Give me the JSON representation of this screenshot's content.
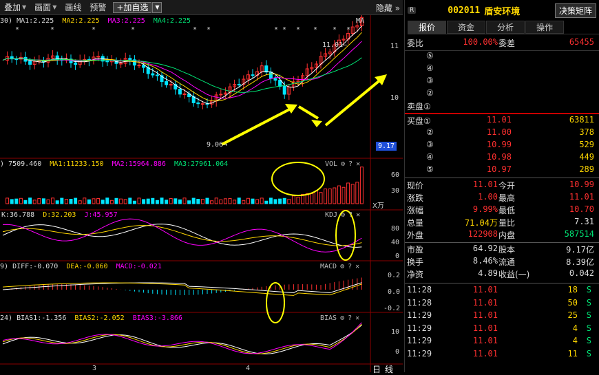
{
  "toolbar": {
    "overlay": "叠加",
    "canvas": "画面",
    "draw_line": "画线",
    "alert": "预警",
    "add_watch": "+加自选",
    "hide": "隐藏"
  },
  "main_chart": {
    "period_prefix": "30)",
    "ma1": "MA1:2.225",
    "ma2": "MA2:2.225",
    "ma3": "MA3:2.225",
    "ma4": "MA4:2.225",
    "ma_label": "MA",
    "high_label": "11.01",
    "low_label": "9.06",
    "axis": [
      "11",
      "10"
    ],
    "current_price": "9.17",
    "stars": [
      "*",
      "*",
      "*",
      "*",
      "*",
      "*",
      "* *",
      "*",
      "*",
      "*",
      "*"
    ]
  },
  "vol_pane": {
    "prefix": ")",
    "value": "7509.460",
    "ma1": "MA1:11233.150",
    "ma2": "MA2:15964.886",
    "ma3": "MA3:27961.064",
    "name": "VOL",
    "axis": [
      "60",
      "30"
    ],
    "unit": "X万"
  },
  "kdj_pane": {
    "k": "K:36.788",
    "d": "D:32.203",
    "j": "J:45.957",
    "name": "KDJ",
    "axis": [
      "80",
      "40",
      "0"
    ]
  },
  "macd_pane": {
    "prefix": "9)",
    "diff": "DIFF:-0.070",
    "dea": "DEA:-0.060",
    "macd": "MACD:-0.021",
    "name": "MACD",
    "axis": [
      "0.2",
      "0.0",
      "-0.2"
    ]
  },
  "bias_pane": {
    "prefix": "24)",
    "bias1": "BIAS1:-1.356",
    "bias2": "BIAS2:-2.052",
    "bias3": "BIAS3:-3.866",
    "name": "BIAS",
    "axis": [
      "10",
      "0"
    ]
  },
  "date_axis": [
    "3",
    "4"
  ],
  "period_buttons": [
    "日",
    "线"
  ],
  "right_panel": {
    "badge": "R",
    "code": "002011",
    "name": "盾安环境",
    "matrix_button": "决策矩阵",
    "tabs": [
      "报价",
      "资金",
      "分析",
      "操作"
    ],
    "weibi_label": "委比",
    "weibi_value": "100.00%",
    "weicha_label": "委差",
    "weicha_value": "65455",
    "sell_levels": [
      "⑤",
      "④",
      "③",
      "②",
      "卖盘①"
    ],
    "buy_orders": [
      {
        "label": "买盘①",
        "price": "11.01",
        "volume": "63811"
      },
      {
        "label": "②",
        "price": "11.00",
        "volume": "378"
      },
      {
        "label": "③",
        "price": "10.99",
        "volume": "529"
      },
      {
        "label": "④",
        "price": "10.98",
        "volume": "449"
      },
      {
        "label": "⑤",
        "price": "10.97",
        "volume": "289"
      }
    ],
    "stats": [
      {
        "l1": "现价",
        "v1": "11.01",
        "c1": "red",
        "l2": "今开",
        "v2": "10.99",
        "c2": "red"
      },
      {
        "l1": "涨跌",
        "v1": "1.00",
        "c1": "red",
        "l2": "最高",
        "v2": "11.01",
        "c2": "red"
      },
      {
        "l1": "涨幅",
        "v1": "9.99%",
        "c1": "red",
        "l2": "最低",
        "v2": "10.70",
        "c2": "red"
      },
      {
        "l1": "总量",
        "v1": "71.04万",
        "c1": "yellow",
        "l2": "量比",
        "v2": "7.31",
        "c2": "white"
      },
      {
        "l1": "外盘",
        "v1": "122908",
        "c1": "red",
        "l2": "内盘",
        "v2": "587514",
        "c2": "green"
      }
    ],
    "stats2": [
      {
        "l1": "市盈",
        "v1": "64.92",
        "l2": "股本",
        "v2": "9.17亿"
      },
      {
        "l1": "换手",
        "v1": "8.46%",
        "l2": "流通",
        "v2": "8.39亿"
      },
      {
        "l1": "净资",
        "v1": "4.89",
        "l2": "收益(一)",
        "v2": "0.042"
      }
    ],
    "ticks": [
      {
        "time": "11:28",
        "price": "11.01",
        "vol": "18",
        "side": "S"
      },
      {
        "time": "11:28",
        "price": "11.01",
        "vol": "50",
        "side": "S"
      },
      {
        "time": "11:29",
        "price": "11.01",
        "vol": "25",
        "side": "S"
      },
      {
        "time": "11:29",
        "price": "11.01",
        "vol": "4",
        "side": "S"
      },
      {
        "time": "11:29",
        "price": "11.01",
        "vol": "4",
        "side": "S"
      },
      {
        "time": "11:29",
        "price": "11.01",
        "vol": "11",
        "side": "S"
      }
    ]
  },
  "colors": {
    "up": "#ff3030",
    "down": "#00e5ff",
    "ma1": "#ffffff",
    "ma2": "#ffd700",
    "ma3": "#ff00ff",
    "ma4": "#00e676",
    "annotation": "#ffff00"
  }
}
